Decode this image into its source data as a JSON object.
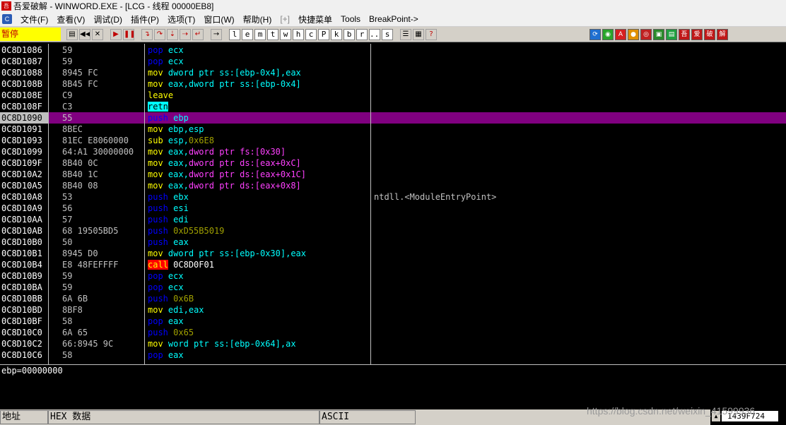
{
  "window": {
    "title": "吾爱破解 - WINWORD.EXE - [LCG - 线程 00000EB8]"
  },
  "menu": {
    "sys_icon_label": "C",
    "items": [
      "文件(F)",
      "查看(V)",
      "调试(D)",
      "插件(P)",
      "选项(T)",
      "窗口(W)",
      "帮助(H)",
      "[+]",
      "快捷菜单",
      "Tools",
      "BreakPoint->"
    ]
  },
  "toolbar": {
    "status": "暂停",
    "nav_icons": [
      "open-icon",
      "rewind-icon",
      "close-icon",
      "run-icon",
      "pause-icon",
      "step-into-icon",
      "step-over-icon",
      "trace-into-icon",
      "trace-over-icon",
      "execute-till-return-icon",
      "goto-icon"
    ],
    "letters": [
      "l",
      "e",
      "m",
      "t",
      "w",
      "h",
      "c",
      "P",
      "k",
      "b",
      "r",
      "...",
      "s"
    ],
    "right_labels": [
      "吾",
      "爱",
      "破",
      "解"
    ]
  },
  "cpu": {
    "rows": [
      {
        "addr": "0C8D1086",
        "hex": "59",
        "mn": "pop",
        "ops": "ecx",
        "comment": ""
      },
      {
        "addr": "0C8D1087",
        "hex": "59",
        "mn": "pop",
        "ops": "ecx",
        "comment": ""
      },
      {
        "addr": "0C8D1088",
        "hex": "8945 FC",
        "mn": "mov",
        "ops": "dword ptr ss:[ebp-0x4],eax",
        "comment": ""
      },
      {
        "addr": "0C8D108B",
        "hex": "8B45 FC",
        "mn": "mov",
        "ops": "eax,dword ptr ss:[ebp-0x4]",
        "comment": ""
      },
      {
        "addr": "0C8D108E",
        "hex": "C9",
        "mn": "leave",
        "ops": "",
        "comment": ""
      },
      {
        "addr": "0C8D108F",
        "hex": "C3",
        "mn": "retn",
        "ops": "",
        "comment": ""
      },
      {
        "addr": "0C8D1090",
        "hex": "55",
        "mn": "push",
        "ops": "ebp",
        "comment": ""
      },
      {
        "addr": "0C8D1091",
        "hex": "8BEC",
        "mn": "mov",
        "ops": "ebp,esp",
        "comment": ""
      },
      {
        "addr": "0C8D1093",
        "hex": "81EC E8060000",
        "mn": "sub",
        "ops": "esp,0x6E8",
        "comment": ""
      },
      {
        "addr": "0C8D1099",
        "hex": "64:A1 30000000",
        "mn": "mov",
        "ops": "eax,dword ptr fs:[0x30]",
        "comment": ""
      },
      {
        "addr": "0C8D109F",
        "hex": "8B40 0C",
        "mn": "mov",
        "ops": "eax,dword ptr ds:[eax+0xC]",
        "comment": ""
      },
      {
        "addr": "0C8D10A2",
        "hex": "8B40 1C",
        "mn": "mov",
        "ops": "eax,dword ptr ds:[eax+0x1C]",
        "comment": ""
      },
      {
        "addr": "0C8D10A5",
        "hex": "8B40 08",
        "mn": "mov",
        "ops": "eax,dword ptr ds:[eax+0x8]",
        "comment": ""
      },
      {
        "addr": "0C8D10A8",
        "hex": "53",
        "mn": "push",
        "ops": "ebx",
        "comment": "ntdll.<ModuleEntryPoint>"
      },
      {
        "addr": "0C8D10A9",
        "hex": "56",
        "mn": "push",
        "ops": "esi",
        "comment": ""
      },
      {
        "addr": "0C8D10AA",
        "hex": "57",
        "mn": "push",
        "ops": "edi",
        "comment": ""
      },
      {
        "addr": "0C8D10AB",
        "hex": "68 19505BD5",
        "mn": "push",
        "ops": "0xD55B5019",
        "comment": ""
      },
      {
        "addr": "0C8D10B0",
        "hex": "50",
        "mn": "push",
        "ops": "eax",
        "comment": ""
      },
      {
        "addr": "0C8D10B1",
        "hex": "8945 D0",
        "mn": "mov",
        "ops": "dword ptr ss:[ebp-0x30],eax",
        "comment": ""
      },
      {
        "addr": "0C8D10B4",
        "hex": "E8 48FEFFFF",
        "mn": "call",
        "ops": "0C8D0F01",
        "comment": ""
      },
      {
        "addr": "0C8D10B9",
        "hex": "59",
        "mn": "pop",
        "ops": "ecx",
        "comment": ""
      },
      {
        "addr": "0C8D10BA",
        "hex": "59",
        "mn": "pop",
        "ops": "ecx",
        "comment": ""
      },
      {
        "addr": "0C8D10BB",
        "hex": "6A 6B",
        "mn": "push",
        "ops": "0x6B",
        "comment": ""
      },
      {
        "addr": "0C8D10BD",
        "hex": "8BF8",
        "mn": "mov",
        "ops": "edi,eax",
        "comment": ""
      },
      {
        "addr": "0C8D10BF",
        "hex": "58",
        "mn": "pop",
        "ops": "eax",
        "comment": ""
      },
      {
        "addr": "0C8D10C0",
        "hex": "6A 65",
        "mn": "push",
        "ops": "0x65",
        "comment": ""
      },
      {
        "addr": "0C8D10C2",
        "hex": "66:8945 9C",
        "mn": "mov",
        "ops": "word ptr ss:[ebp-0x64],ax",
        "comment": ""
      },
      {
        "addr": "0C8D10C6",
        "hex": "58",
        "mn": "pop",
        "ops": "eax",
        "comment": ""
      }
    ],
    "selected_row": "0C8D1090"
  },
  "info": {
    "text": "ebp=00000000"
  },
  "dump": {
    "col_addr": "地址",
    "col_hex": "HEX 数据",
    "col_ascii": "ASCII"
  },
  "stack": {
    "top_value": "1439F724"
  },
  "watermark": "https://blog.csdn.net/weixin_41599936",
  "colors": {
    "highlight": "#800080",
    "background": "#000000",
    "call": "#ff0000",
    "retn": "#00ffff"
  }
}
